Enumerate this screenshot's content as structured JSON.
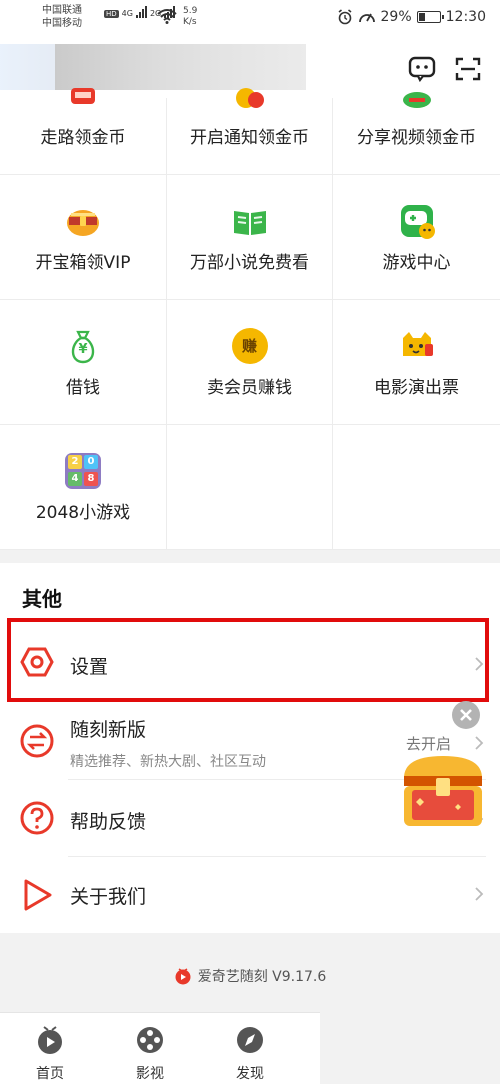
{
  "status_bar": {
    "carrier_1": "中国联通",
    "carrier_2": "中国移动",
    "hd": "HD",
    "net_4g": "4G",
    "net_2g": "2G",
    "speed_value": "5.9",
    "speed_unit": "K/s",
    "battery": "29%",
    "time": "12:30"
  },
  "header": {
    "icons": [
      "message-icon",
      "scan-icon"
    ]
  },
  "grid": {
    "items": [
      {
        "label": "走路领金币",
        "icon": "walk-coin-icon"
      },
      {
        "label": "开启通知领金币",
        "icon": "notify-coin-icon"
      },
      {
        "label": "分享视频领金币",
        "icon": "share-coin-icon"
      },
      {
        "label": "开宝箱领VIP",
        "icon": "treasure-chest-icon"
      },
      {
        "label": "万部小说免费看",
        "icon": "book-icon"
      },
      {
        "label": "游戏中心",
        "icon": "gamepad-icon"
      },
      {
        "label": "借钱",
        "icon": "money-bag-icon"
      },
      {
        "label": "卖会员赚钱",
        "icon": "earn-coin-icon"
      },
      {
        "label": "电影演出票",
        "icon": "ticket-cat-icon"
      },
      {
        "label": "2048小游戏",
        "icon": "game-2048-icon"
      }
    ],
    "earn_glyph": "赚",
    "money_glyph": "¥",
    "game_2048_digits": [
      "2",
      "0",
      "4",
      "8"
    ]
  },
  "other": {
    "title": "其他",
    "settings_label": "设置",
    "suike_label": "随刻新版",
    "suike_sub": "精选推荐、新热大剧、社区互动",
    "help_label": "帮助反馈",
    "about_label": "关于我们"
  },
  "floating": {
    "action_text": "去开启"
  },
  "version": {
    "text": "爱奇艺随刻 V9.17.6"
  },
  "tabbar": {
    "tabs": [
      {
        "label": "首页",
        "icon": "home-icon"
      },
      {
        "label": "影视",
        "icon": "film-reel-icon"
      },
      {
        "label": "发现",
        "icon": "compass-icon"
      }
    ]
  },
  "colors": {
    "accent_red": "#e10c0c",
    "brand_red": "#e8392a",
    "coin_gold": "#f5b700",
    "green": "#3bb54a"
  }
}
